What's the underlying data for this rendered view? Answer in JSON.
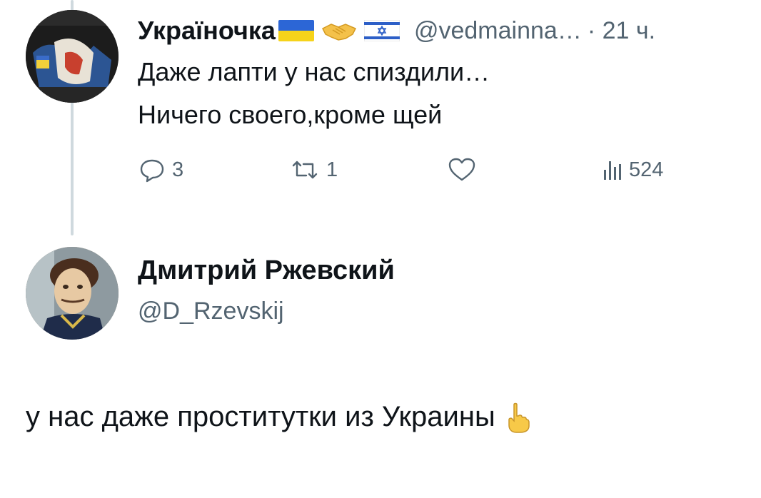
{
  "reply_context": {
    "author": {
      "display_name": "Україночка",
      "handle": "@vedmainna…",
      "time": "· 21 ч.",
      "avatar_icon": "avatar-poster-icon",
      "badges": [
        "ukraine-flag-icon",
        "handshake-icon",
        "israel-flag-icon"
      ]
    },
    "text_lines": [
      "Даже лапти у нас спиздили…",
      "Ничего своего,кроме щей"
    ],
    "actions": {
      "replies": "3",
      "reposts": "1",
      "likes": "",
      "views": "524"
    }
  },
  "tweet": {
    "author": {
      "display_name": "Дмитрий Ржевский",
      "handle": "@D_Rzevskij",
      "avatar_icon": "avatar-portrait-icon"
    },
    "text": "у нас даже проститутки из Украины",
    "emoji": "point-up-icon"
  },
  "colors": {
    "text": "#0f1419",
    "secondary": "#536471",
    "thread_line": "#cfd9de",
    "ua_blue": "#2c66d6",
    "ua_yellow": "#f6d31a",
    "il_blue": "#2d5fc7"
  }
}
